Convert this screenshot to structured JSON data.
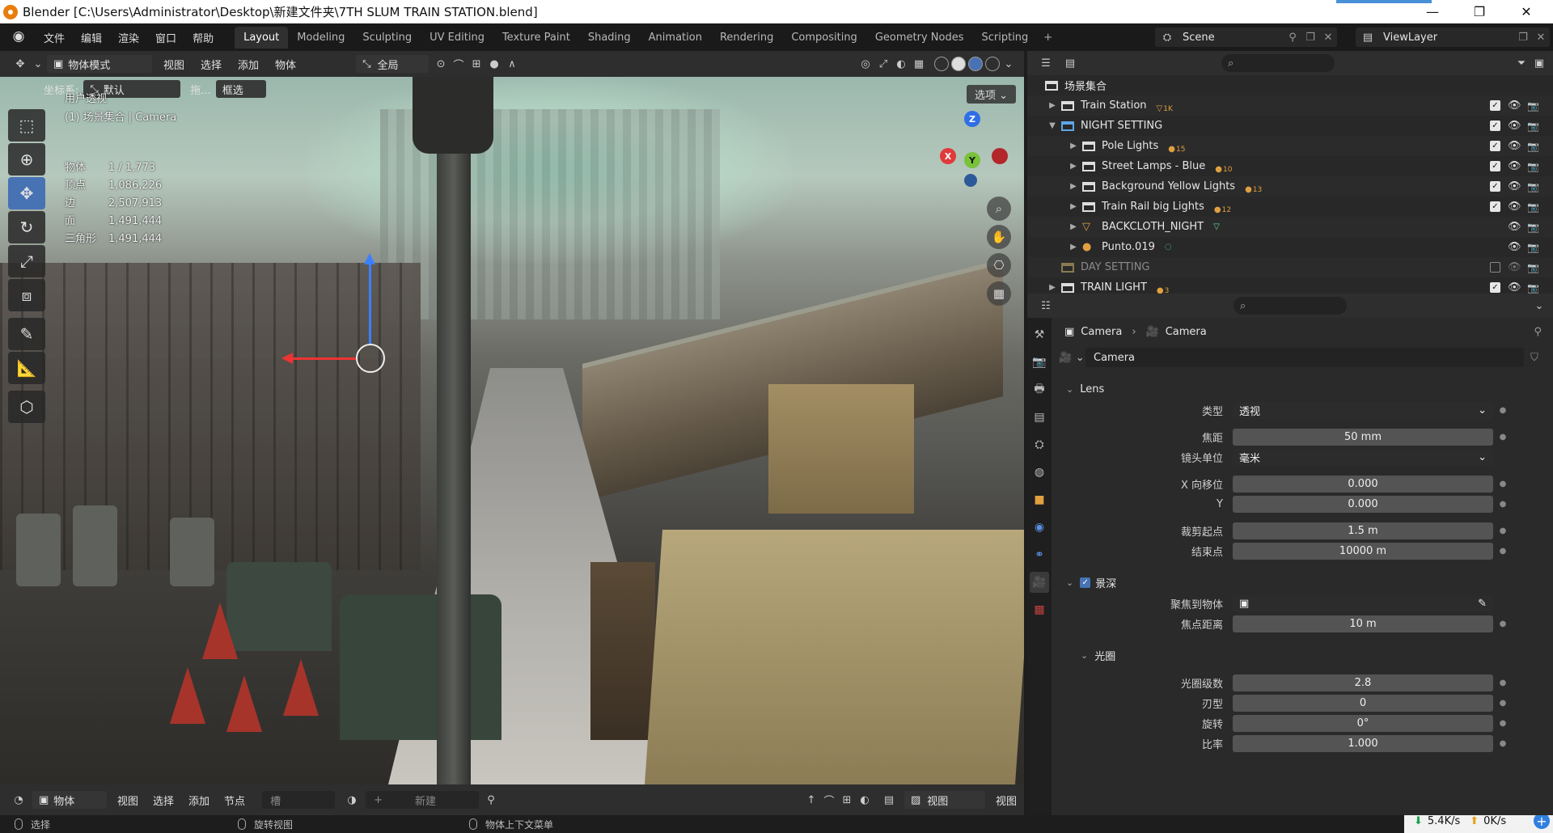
{
  "window": {
    "title": "Blender [C:\\Users\\Administrator\\Desktop\\新建文件夹\\7TH SLUM TRAIN STATION.blend]",
    "minimize": "—",
    "maximize": "❐",
    "close": "✕"
  },
  "menu": {
    "items": [
      "文件",
      "编辑",
      "渲染",
      "窗口",
      "帮助"
    ],
    "tabs": [
      "Layout",
      "Modeling",
      "Sculpting",
      "UV Editing",
      "Texture Paint",
      "Shading",
      "Animation",
      "Rendering",
      "Compositing",
      "Geometry Nodes",
      "Scripting"
    ],
    "active_tab": "Layout",
    "add_tab": "+",
    "scene": "Scene",
    "view_layer": "ViewLayer"
  },
  "viewport_header": {
    "mode": "物体模式",
    "menus": [
      "视图",
      "选择",
      "添加",
      "物体"
    ],
    "transform_orientation": "全局",
    "coord_label": "坐标系:",
    "coord_value": "默认",
    "drag_label": "拖...",
    "drag_value": "框选",
    "options": "选项"
  },
  "viewport": {
    "view_name": "用户透视",
    "collection_camera": "(1) 场景集合 | Camera",
    "stats": [
      {
        "k": "物体",
        "v": "1 / 1,773"
      },
      {
        "k": "顶点",
        "v": "1,086,226"
      },
      {
        "k": "边",
        "v": "2,507,913"
      },
      {
        "k": "面",
        "v": "1,491,444"
      },
      {
        "k": "三角形",
        "v": "1,491,444"
      }
    ],
    "gizmo_axes": {
      "x": "X",
      "y": "Y",
      "z": "Z"
    }
  },
  "bottom_header": {
    "editor": "物体",
    "menus": [
      "视图",
      "选择",
      "添加",
      "节点"
    ],
    "slot": "槽",
    "new_btn": "新建",
    "right_view": "视图",
    "right_view2": "视图"
  },
  "statusbar": {
    "select": "选择",
    "rotate": "旋转视图",
    "context": "物体上下文菜单"
  },
  "net": {
    "down": "5.4K/s",
    "up": "0K/s"
  },
  "outliner": {
    "rows": [
      {
        "name": "场景集合",
        "badge": "",
        "indent": 0
      },
      {
        "name": "Train Station",
        "badge": "1K",
        "indent": 1
      },
      {
        "name": "NIGHT SETTING",
        "badge": "",
        "indent": 1
      },
      {
        "name": "Pole Lights",
        "badge": "15",
        "indent": 2
      },
      {
        "name": "Street Lamps - Blue",
        "badge": "10",
        "indent": 2
      },
      {
        "name": "Background Yellow Lights",
        "badge": "13",
        "indent": 2
      },
      {
        "name": "Train Rail big Lights",
        "badge": "12",
        "indent": 2
      },
      {
        "name": "BACKCLOTH_NIGHT",
        "badge": "",
        "indent": 2
      },
      {
        "name": "Punto.019",
        "badge": "",
        "indent": 2
      },
      {
        "name": "DAY SETTING",
        "badge": "",
        "indent": 1
      },
      {
        "name": "TRAIN LIGHT",
        "badge": "3",
        "indent": 1
      }
    ]
  },
  "properties": {
    "crumb_object": "Camera",
    "crumb_data": "Camera",
    "datablock": "Camera",
    "lens_panel": "Lens",
    "type_label": "类型",
    "type_value": "透视",
    "focal_label": "焦距",
    "focal_value": "50 mm",
    "lens_unit_label": "镜头单位",
    "lens_unit_value": "毫米",
    "shift_x_label": "X 向移位",
    "shift_x_value": "0.000",
    "shift_y_label": "Y",
    "shift_y_value": "0.000",
    "clip_start_label": "裁剪起点",
    "clip_start_value": "1.5 m",
    "clip_end_label": "结束点",
    "clip_end_value": "10000 m",
    "dof_panel": "景深",
    "focus_obj_label": "聚焦到物体",
    "focus_dist_label": "焦点距离",
    "focus_dist_value": "10 m",
    "aperture_panel": "光圈",
    "fstop_label": "光圈级数",
    "fstop_value": "2.8",
    "blades_label": "刃型",
    "blades_value": "0",
    "rotation_label": "旋转",
    "rotation_value": "0°",
    "ratio_label": "比率",
    "ratio_value": "1.000"
  }
}
